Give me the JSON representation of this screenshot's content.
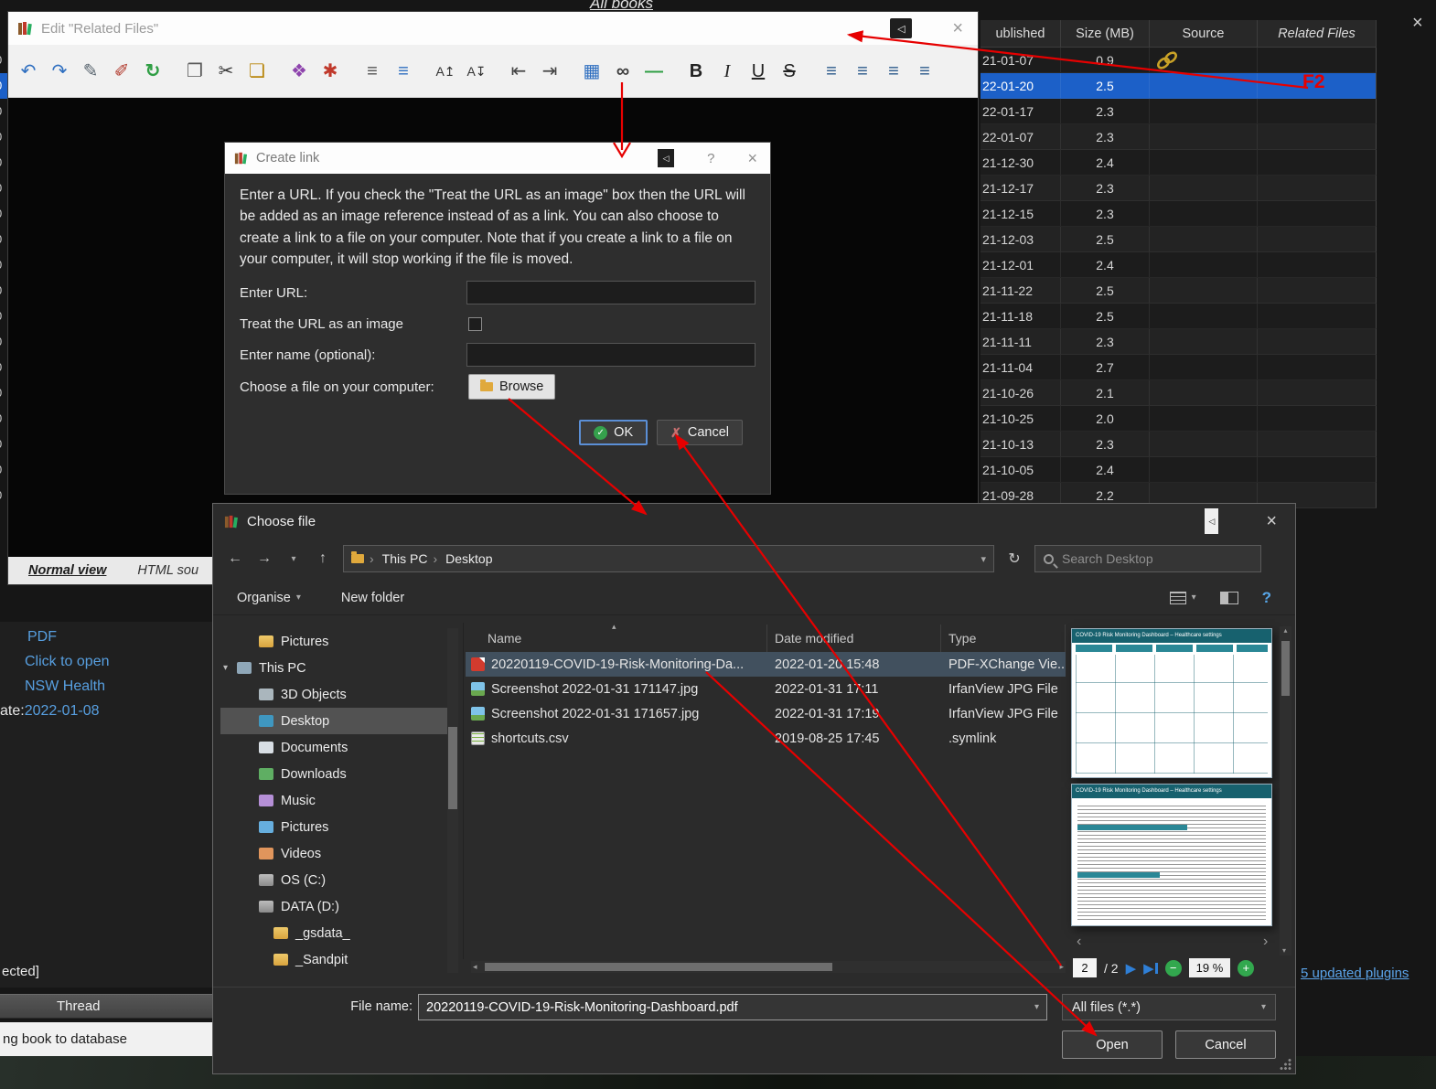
{
  "app": {
    "all_books_label": "All books",
    "window_close_icon": "×",
    "updated_plugins_link": "5 updated plugins"
  },
  "annotations": {
    "f2_label": "F2"
  },
  "background": {
    "book_details": {
      "format_label": "PDF",
      "open_link": "Click to open",
      "publisher_link": "NSW Health",
      "date_label": "ate:",
      "date_value": "2022-01-08"
    },
    "selected_fragment": "ected]",
    "jobs_header": "Thread",
    "status_message": "ng book to database"
  },
  "books": {
    "edge_digit": "0",
    "headers": {
      "published": "ublished",
      "size": "Size (MB)",
      "source": "Source",
      "related_files": "Related Files"
    },
    "rows": [
      {
        "date": "21-01-07",
        "size": "0.9",
        "has_link_icon": true
      },
      {
        "date": "22-01-20",
        "size": "2.5",
        "selected": true
      },
      {
        "date": "22-01-17",
        "size": "2.3"
      },
      {
        "date": "22-01-07",
        "size": "2.3"
      },
      {
        "date": "21-12-30",
        "size": "2.4"
      },
      {
        "date": "21-12-17",
        "size": "2.3"
      },
      {
        "date": "21-12-15",
        "size": "2.3"
      },
      {
        "date": "21-12-03",
        "size": "2.5"
      },
      {
        "date": "21-12-01",
        "size": "2.4"
      },
      {
        "date": "21-11-22",
        "size": "2.5"
      },
      {
        "date": "21-11-18",
        "size": "2.5"
      },
      {
        "date": "21-11-11",
        "size": "2.3"
      },
      {
        "date": "21-11-04",
        "size": "2.7"
      },
      {
        "date": "21-10-26",
        "size": "2.1"
      },
      {
        "date": "21-10-25",
        "size": "2.0"
      },
      {
        "date": "21-10-13",
        "size": "2.3"
      },
      {
        "date": "21-10-05",
        "size": "2.4"
      },
      {
        "date": "21-09-28",
        "size": "2.2"
      }
    ]
  },
  "editor_window": {
    "title": "Edit \"Related Files\"",
    "osd_icon": "◁",
    "close_icon": "×",
    "toolbar_icons": [
      {
        "g": "↶",
        "style": "color:#2f6fc0"
      },
      {
        "g": "↷",
        "style": "color:#2f6fc0"
      },
      {
        "g": "✎",
        "style": "color:#5a6670"
      },
      {
        "g": "✐",
        "style": "color:#b23b2e"
      },
      {
        "g": "↻",
        "style": "color:#2f9e44;font-weight:bold"
      },
      {
        "g": "❐",
        "style": "color:#5a5a5a",
        "grp": true
      },
      {
        "g": "✂",
        "style": "color:#333"
      },
      {
        "g": "❏",
        "style": "color:#b8860b"
      },
      {
        "g": "❖",
        "style": "color:#8e44ad",
        "grp": true
      },
      {
        "g": "✱",
        "style": "color:#c0392b"
      },
      {
        "g": "≡",
        "style": "color:#555",
        "grp": true
      },
      {
        "g": "≡",
        "style": "color:#2f6fc0"
      },
      {
        "g": "A↥",
        "style": "color:#333;font-size:14px",
        "grp": true
      },
      {
        "g": "A↧",
        "style": "color:#333;font-size:14px"
      },
      {
        "g": "⇤",
        "style": "color:#444",
        "grp": true
      },
      {
        "g": "⇥",
        "style": "color:#444"
      },
      {
        "g": "▦",
        "style": "color:#2f6fc0",
        "grp": true
      },
      {
        "g": "∞",
        "style": "color:#3c3c3c;font-weight:bold"
      },
      {
        "g": "—",
        "style": "color:#2f9e44;font-weight:bold"
      },
      {
        "g": "B",
        "style": "color:#222;font-weight:bold",
        "grp": true
      },
      {
        "g": "I",
        "style": "color:#222;font-style:italic;font-family:'Liberation Serif',serif"
      },
      {
        "g": "U",
        "style": "color:#222;text-decoration:underline"
      },
      {
        "g": "S",
        "style": "color:#222;text-decoration:line-through"
      },
      {
        "g": "≡",
        "style": "color:#2c5a8c",
        "grp": true
      },
      {
        "g": "≡",
        "style": "color:#2c5a8c"
      },
      {
        "g": "≡",
        "style": "color:#2c5a8c"
      },
      {
        "g": "≡",
        "style": "color:#2c5a8c"
      }
    ],
    "tabs": {
      "normal_view": "Normal view",
      "html_source": "HTML sou"
    }
  },
  "create_link": {
    "title": "Create link",
    "osd_icon": "◁",
    "help_icon": "?",
    "close_icon": "×",
    "body_text": "Enter a URL. If you check the \"Treat the URL as an image\" box then the URL will be added as an image reference instead of as a link. You can also choose to create a link to a file on your computer. Note that if you create a link to a file on your computer, it will stop working if the file is moved.",
    "url_label": "Enter URL:",
    "url_value": "",
    "image_checkbox_label": "Treat the URL as an image",
    "name_label": "Enter name (optional):",
    "name_value": "",
    "file_label": "Choose a file on your computer:",
    "browse_button": "Browse",
    "ok_button": "OK",
    "cancel_button": "Cancel"
  },
  "choose_file": {
    "title": "Choose file",
    "osd_icon": "◁",
    "close_icon": "×",
    "nav": {
      "back": "←",
      "forward": "→",
      "down": "▾",
      "up": "↑",
      "refresh": "↻"
    },
    "breadcrumb": [
      "This PC",
      "Desktop"
    ],
    "search_placeholder": "Search Desktop",
    "organise_button": "Organise",
    "new_folder_button": "New folder",
    "help_icon": "?",
    "chevron_icon": "▾",
    "columns": {
      "name": "Name",
      "modified": "Date modified",
      "type": "Type"
    },
    "sidebar": [
      {
        "label": "Pictures",
        "icon_cls": "si-folder",
        "icon_name": "folder-icon",
        "ind": "ind1"
      },
      {
        "label": "This PC",
        "icon_cls": "si-pc",
        "icon_name": "computer-icon",
        "ind": "ind0",
        "expanded": true
      },
      {
        "label": "3D Objects",
        "icon_cls": "si-cube",
        "icon_name": "3d-objects-icon",
        "ind": "ind1"
      },
      {
        "label": "Desktop",
        "icon_cls": "si-desktop",
        "icon_name": "desktop-icon",
        "ind": "ind1",
        "selected": true
      },
      {
        "label": "Documents",
        "icon_cls": "si-doc",
        "icon_name": "documents-icon",
        "ind": "ind1"
      },
      {
        "label": "Downloads",
        "icon_cls": "si-down",
        "icon_name": "downloads-icon",
        "ind": "ind1"
      },
      {
        "label": "Music",
        "icon_cls": "si-music",
        "icon_name": "music-icon",
        "ind": "ind1"
      },
      {
        "label": "Pictures",
        "icon_cls": "si-pics",
        "icon_name": "pictures-icon",
        "ind": "ind1"
      },
      {
        "label": "Videos",
        "icon_cls": "si-video",
        "icon_name": "videos-icon",
        "ind": "ind1"
      },
      {
        "label": "OS (C:)",
        "icon_cls": "si-drive",
        "icon_name": "drive-icon",
        "ind": "ind1"
      },
      {
        "label": "DATA (D:)",
        "icon_cls": "si-drive",
        "icon_name": "drive-icon",
        "ind": "ind1"
      },
      {
        "label": "_gsdata_",
        "icon_cls": "si-folder",
        "icon_name": "folder-icon",
        "ind": "ind2"
      },
      {
        "label": "_Sandpit",
        "icon_cls": "si-folder",
        "icon_name": "folder-icon",
        "ind": "ind2"
      }
    ],
    "files": [
      {
        "name": "20220119-COVID-19-Risk-Monitoring-Da...",
        "modified": "2022-01-20 15:48",
        "type": "PDF-XChange Vie...",
        "icon_cls": "fi-pdf",
        "icon_name": "pdf-icon",
        "selected": true
      },
      {
        "name": "Screenshot 2022-01-31 171147.jpg",
        "modified": "2022-01-31 17:11",
        "type": "IrfanView JPG File",
        "icon_cls": "fi-img",
        "icon_name": "image-icon"
      },
      {
        "name": "Screenshot 2022-01-31 171657.jpg",
        "modified": "2022-01-31 17:19",
        "type": "IrfanView JPG File",
        "icon_cls": "fi-img",
        "icon_name": "image-icon"
      },
      {
        "name": "shortcuts.csv",
        "modified": "2019-08-25 17:45",
        "type": ".symlink",
        "icon_cls": "fi-csv",
        "icon_name": "csv-icon"
      }
    ],
    "preview": {
      "page_title": "COVID-19 Risk Monitoring Dashboard – Healthcare settings",
      "page_current": "2",
      "page_total": "/ 2",
      "zoom_level": "19 %"
    },
    "filename_label": "File name:",
    "filename_value": "20220119-COVID-19-Risk-Monitoring-Dashboard.pdf",
    "filetype_value": "All files (*.*)",
    "open_button": "Open",
    "cancel_button": "Cancel"
  }
}
